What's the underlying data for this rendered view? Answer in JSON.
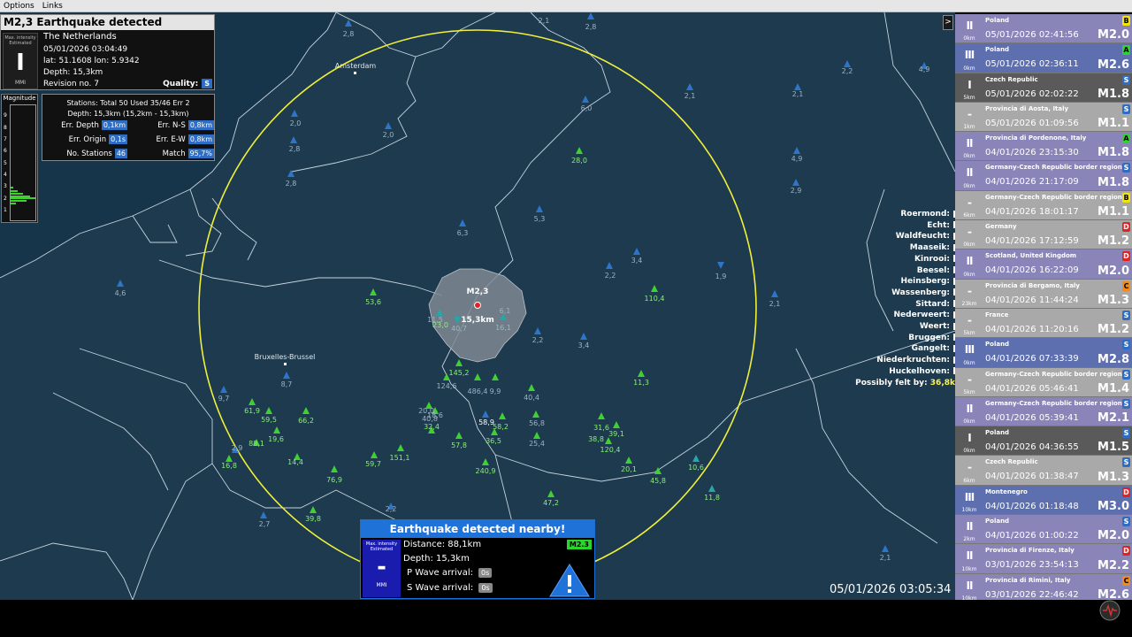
{
  "menu": [
    "Options",
    "Links"
  ],
  "event": {
    "title": "M2,3 Earthquake detected",
    "region": "The Netherlands",
    "datetime": "05/01/2026 03:04:49",
    "latlon": "lat: 51.1608 lon: 5.9342",
    "depth": "Depth: 15,3km",
    "revision": "Revision no. 7",
    "quality_label": "Quality:",
    "quality_value": "S",
    "mmi_caption_1": "Max. intensity",
    "mmi_caption_2": "Estimated",
    "mmi_value": "I",
    "mmi_unit": "MMI"
  },
  "magnitude_chart": {
    "title": "Magnitude",
    "ticks": [
      "9",
      "8",
      "7",
      "6",
      "5",
      "4",
      "3",
      "2",
      "1"
    ]
  },
  "stations": {
    "summary": "Stations: Total 50 Used 35/46 Err 2",
    "depth_range": "Depth: 15,3km (15,2km - 15,3km)",
    "err_depth_label": "Err. Depth",
    "err_depth_value": "0,1km",
    "err_ns_label": "Err. N-S",
    "err_ns_value": "0,8km",
    "err_origin_label": "Err. Origin",
    "err_origin_value": "0,1s",
    "err_ew_label": "Err. E-W",
    "err_ew_value": "0,8km",
    "num_label": "No. Stations",
    "num_value": "46",
    "match_label": "Match",
    "match_value": "95,7%"
  },
  "map": {
    "epicenter_mag": "M2,3",
    "epicenter_depth": "15,3km",
    "cities": [
      {
        "name": "Amsterdam"
      },
      {
        "name": "Bruxelles-Brussel"
      }
    ]
  },
  "city_list": {
    "items": [
      "Roermond:",
      "Echt:",
      "Waldfeucht:",
      "Maaseik:",
      "Kinrooi:",
      "Beesel:",
      "Heinsberg:",
      "Wassenberg:",
      "Sittard:",
      "Nederweert:",
      "Weert:",
      "Bruggen:",
      "Gangelt:",
      "Niederkruchten:",
      "Huckelhoven:"
    ],
    "felt_label": "Possibly felt by:",
    "felt_value": "36,8k"
  },
  "quake_list": [
    {
      "mmi": "II",
      "dist": "0km",
      "region": "Poland",
      "time": "05/01/2026 02:41:56",
      "mag": "M2.0",
      "q": "B",
      "qcolor": "#f2e40e",
      "bg": "#8a85b8"
    },
    {
      "mmi": "III",
      "dist": "0km",
      "region": "Poland",
      "time": "05/01/2026 02:36:11",
      "mag": "M2.6",
      "q": "A",
      "qcolor": "#2ed32e",
      "bg": "#5e6fb0"
    },
    {
      "mmi": "I",
      "dist": "5km",
      "region": "Czech Republic",
      "time": "05/01/2026 02:02:22",
      "mag": "M1.8",
      "q": "S",
      "qcolor": "#2d6dc4",
      "bg": "#5a5a5a"
    },
    {
      "mmi": "-",
      "dist": "1km",
      "region": "Provincia di Aosta, Italy",
      "time": "05/01/2026 01:09:56",
      "mag": "M1.1",
      "q": "S",
      "qcolor": "#2d6dc4",
      "bg": "#a9a9a9"
    },
    {
      "mmi": "II",
      "dist": "0km",
      "region": "Provincia di Pordenone, Italy",
      "time": "04/01/2026 23:15:30",
      "mag": "M1.8",
      "q": "A",
      "qcolor": "#2ed32e",
      "bg": "#8a85b8"
    },
    {
      "mmi": "II",
      "dist": "0km",
      "region": "Germany-Czech Republic border region",
      "time": "04/01/2026 21:17:09",
      "mag": "M1.8",
      "q": "S",
      "qcolor": "#2d6dc4",
      "bg": "#8a85b8"
    },
    {
      "mmi": "-",
      "dist": "6km",
      "region": "Germany-Czech Republic border region",
      "time": "04/01/2026 18:01:17",
      "mag": "M1.1",
      "q": "B",
      "qcolor": "#f2e40e",
      "bg": "#a9a9a9"
    },
    {
      "mmi": "-",
      "dist": "0km",
      "region": "Germany",
      "time": "04/01/2026 17:12:59",
      "mag": "M1.2",
      "q": "D",
      "qcolor": "#e02424",
      "bg": "#a9a9a9"
    },
    {
      "mmi": "II",
      "dist": "0km",
      "region": "Scotland, United Kingdom",
      "time": "04/01/2026 16:22:09",
      "mag": "M2.0",
      "q": "D",
      "qcolor": "#e02424",
      "bg": "#8a85b8"
    },
    {
      "mmi": "-",
      "dist": "23km",
      "region": "Provincia di Bergamo, Italy",
      "time": "04/01/2026 11:44:24",
      "mag": "M1.3",
      "q": "C",
      "qcolor": "#f08a1a",
      "bg": "#a9a9a9"
    },
    {
      "mmi": "-",
      "dist": "5km",
      "region": "France",
      "time": "04/01/2026 11:20:16",
      "mag": "M1.2",
      "q": "S",
      "qcolor": "#2d6dc4",
      "bg": "#a9a9a9"
    },
    {
      "mmi": "III",
      "dist": "0km",
      "region": "Poland",
      "time": "04/01/2026 07:33:39",
      "mag": "M2.8",
      "q": "S",
      "qcolor": "#2d6dc4",
      "bg": "#5e6fb0"
    },
    {
      "mmi": "-",
      "dist": "5km",
      "region": "Germany-Czech Republic border region",
      "time": "04/01/2026 05:46:41",
      "mag": "M1.4",
      "q": "S",
      "qcolor": "#2d6dc4",
      "bg": "#a9a9a9"
    },
    {
      "mmi": "II",
      "dist": "0km",
      "region": "Germany-Czech Republic border region",
      "time": "04/01/2026 05:39:41",
      "mag": "M2.1",
      "q": "S",
      "qcolor": "#2d6dc4",
      "bg": "#8a85b8"
    },
    {
      "mmi": "I",
      "dist": "0km",
      "region": "Poland",
      "time": "04/01/2026 04:36:55",
      "mag": "M1.5",
      "q": "S",
      "qcolor": "#2d6dc4",
      "bg": "#5a5a5a"
    },
    {
      "mmi": "-",
      "dist": "6km",
      "region": "Czech Republic",
      "time": "04/01/2026 01:38:47",
      "mag": "M1.3",
      "q": "S",
      "qcolor": "#2d6dc4",
      "bg": "#a9a9a9"
    },
    {
      "mmi": "III",
      "dist": "10km",
      "region": "Montenegro",
      "time": "04/01/2026 01:18:48",
      "mag": "M3.0",
      "q": "D",
      "qcolor": "#e02424",
      "bg": "#5e6fb0"
    },
    {
      "mmi": "II",
      "dist": "2km",
      "region": "Poland",
      "time": "04/01/2026 01:00:22",
      "mag": "M2.0",
      "q": "S",
      "qcolor": "#2d6dc4",
      "bg": "#8a85b8"
    },
    {
      "mmi": "II",
      "dist": "10km",
      "region": "Provincia di Firenze, Italy",
      "time": "03/01/2026 23:54:13",
      "mag": "M2.2",
      "q": "D",
      "qcolor": "#e02424",
      "bg": "#8a85b8"
    },
    {
      "mmi": "II",
      "dist": "10km",
      "region": "Provincia di Rimini, Italy",
      "time": "03/01/2026 22:46:42",
      "mag": "M2.6",
      "q": "C",
      "qcolor": "#f08a1a",
      "bg": "#8a85b8"
    }
  ],
  "alert": {
    "title": "Earthquake detected nearby!",
    "mmi_caption_1": "Max. intensity",
    "mmi_caption_2": "Estimated",
    "mmi_value": "-",
    "mmi_unit": "MMI",
    "distance": "Distance: 88,1km",
    "depth": "Depth: 15,3km",
    "p_label": "P Wave arrival:",
    "p_value": "0s",
    "s_label": "S Wave arrival:",
    "s_value": "0s",
    "mag": "M2.3"
  },
  "clock": "05/01/2026 03:05:34",
  "colors": {
    "sea": "#16344a",
    "land_border": "#c6d3dc",
    "circle": "#f0f03a",
    "station_blue": "#2e74c9",
    "station_green": "#3fd12f",
    "alert_blue": "#1f72d8"
  }
}
